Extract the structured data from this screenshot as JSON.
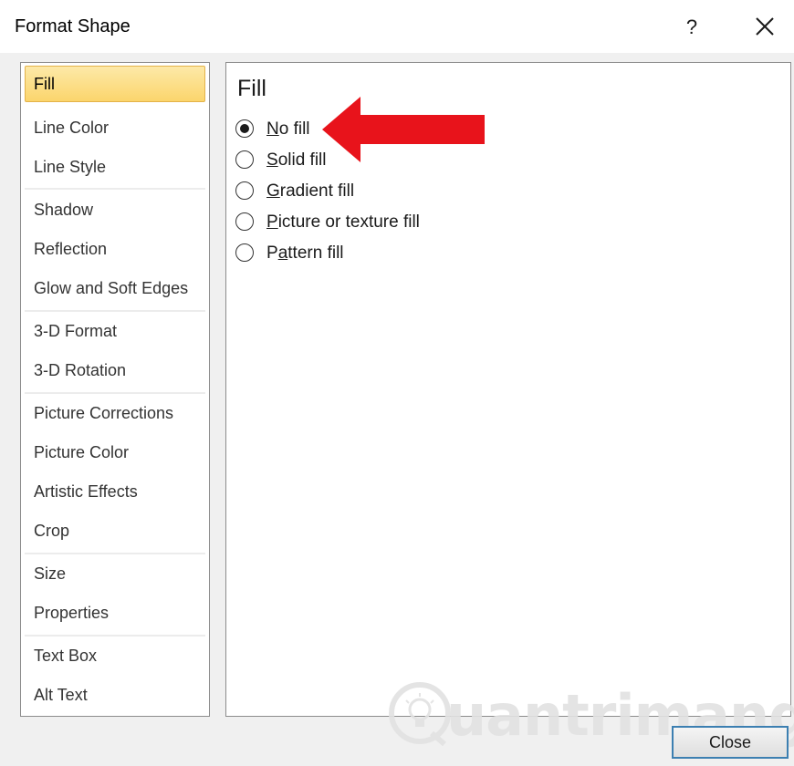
{
  "window": {
    "title": "Format Shape",
    "help_label": "?",
    "close_icon": "close-icon"
  },
  "nav": {
    "selected_index": 0,
    "items": [
      {
        "label": "Fill"
      },
      {
        "label": "Line Color"
      },
      {
        "label": "Line Style"
      },
      {
        "label": "Shadow"
      },
      {
        "label": "Reflection"
      },
      {
        "label": "Glow and Soft Edges"
      },
      {
        "label": "3-D Format"
      },
      {
        "label": "3-D Rotation"
      },
      {
        "label": "Picture Corrections"
      },
      {
        "label": "Picture Color"
      },
      {
        "label": "Artistic Effects"
      },
      {
        "label": "Crop"
      },
      {
        "label": "Size"
      },
      {
        "label": "Properties"
      },
      {
        "label": "Text Box"
      },
      {
        "label": "Alt Text"
      }
    ]
  },
  "panel": {
    "heading": "Fill",
    "options": [
      {
        "mnemonic": "N",
        "rest": "o fill",
        "checked": true
      },
      {
        "mnemonic": "S",
        "rest": "olid fill",
        "checked": false
      },
      {
        "mnemonic": "G",
        "rest": "radient fill",
        "checked": false
      },
      {
        "mnemonic": "P",
        "rest": "icture or texture fill",
        "checked": false
      },
      {
        "prefix": "P",
        "mnemonic": "a",
        "rest": "ttern fill",
        "checked": false
      }
    ]
  },
  "annotation": {
    "arrow_color": "#e8131b"
  },
  "watermark": {
    "text": "uantrimang"
  },
  "footer": {
    "close_label": "Close"
  },
  "colors": {
    "selected_bg": "#fbd56c",
    "accent_border": "#3c7fb1"
  }
}
